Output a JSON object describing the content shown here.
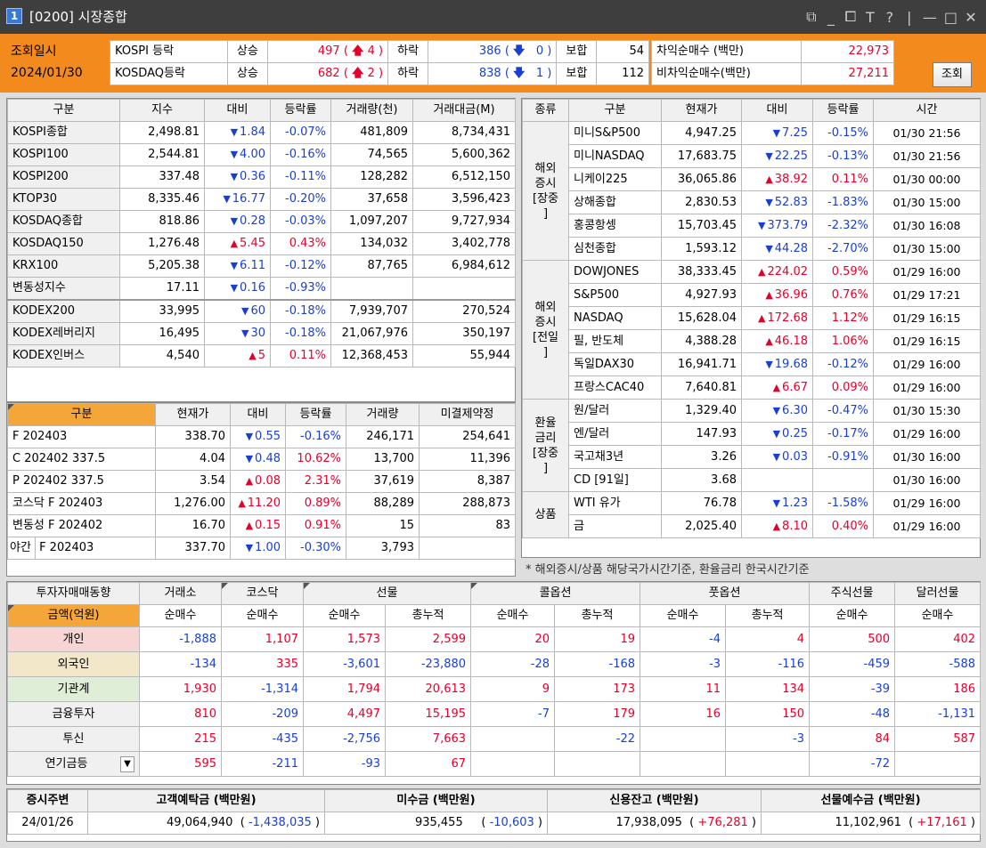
{
  "window": {
    "screen_number": "1",
    "title": "[0200] 시장종합",
    "tools": [
      "⧉",
      "_",
      "⧠",
      "T",
      "?",
      "|",
      "—",
      "□",
      "✕"
    ]
  },
  "header": {
    "query_date_label": "조회일시",
    "query_date": "2024/01/30",
    "rows": [
      {
        "market": "KOSPI 등락",
        "rise_label": "상승",
        "rise": "497",
        "upper": "4",
        "fall_label": "하락",
        "fall": "386",
        "lower": "0",
        "flat_label": "보합",
        "flat": "54"
      },
      {
        "market": "KOSDAQ등락",
        "rise_label": "상승",
        "rise": "682",
        "upper": "2",
        "fall_label": "하락",
        "fall": "838",
        "lower": "1",
        "flat_label": "보합",
        "flat": "112"
      }
    ],
    "arb_label": "차익순매수  (백만)",
    "arb_value": "22,973",
    "nonarb_label": "비차익순매수(백만)",
    "nonarb_value": "27,211",
    "search_button": "조회"
  },
  "index_table": {
    "headers": [
      "구분",
      "지수",
      "대비",
      "등락률",
      "거래량(천)",
      "거래대금(M)"
    ],
    "rows": [
      {
        "name": "KOSPI종합",
        "value": "2,498.81",
        "dir": "dn",
        "change": "1.84",
        "rate": "-0.07%",
        "volume": "481,809",
        "amount": "8,734,431"
      },
      {
        "name": "KOSPI100",
        "value": "2,544.81",
        "dir": "dn",
        "change": "4.00",
        "rate": "-0.16%",
        "volume": "74,565",
        "amount": "5,600,362"
      },
      {
        "name": "KOSPI200",
        "value": "337.48",
        "dir": "dn",
        "change": "0.36",
        "rate": "-0.11%",
        "volume": "128,282",
        "amount": "6,512,150"
      },
      {
        "name": "KTOP30",
        "value": "8,335.46",
        "dir": "dn",
        "change": "16.77",
        "rate": "-0.20%",
        "volume": "37,658",
        "amount": "3,596,423"
      },
      {
        "name": "KOSDAQ종합",
        "value": "818.86",
        "dir": "dn",
        "change": "0.28",
        "rate": "-0.03%",
        "volume": "1,097,207",
        "amount": "9,727,934"
      },
      {
        "name": "KOSDAQ150",
        "value": "1,276.48",
        "dir": "up",
        "change": "5.45",
        "rate": "0.43%",
        "volume": "134,032",
        "amount": "3,402,778"
      },
      {
        "name": "KRX100",
        "value": "5,205.38",
        "dir": "dn",
        "change": "6.11",
        "rate": "-0.12%",
        "volume": "87,765",
        "amount": "6,984,612"
      },
      {
        "name": "변동성지수",
        "value": "17.11",
        "dir": "dn",
        "change": "0.16",
        "rate": "-0.93%",
        "volume": "",
        "amount": ""
      },
      {
        "name": "KODEX200",
        "value": "33,995",
        "dir": "dn",
        "change": "60",
        "rate": "-0.18%",
        "volume": "7,939,707",
        "amount": "270,524"
      },
      {
        "name": "KODEX레버리지",
        "value": "16,495",
        "dir": "dn",
        "change": "30",
        "rate": "-0.18%",
        "volume": "21,067,976",
        "amount": "350,197"
      },
      {
        "name": "KODEX인버스",
        "value": "4,540",
        "dir": "up",
        "change": "5",
        "rate": "0.11%",
        "volume": "12,368,453",
        "amount": "55,944"
      }
    ]
  },
  "futures_table": {
    "headers": [
      "구분",
      "현재가",
      "대비",
      "등락률",
      "거래량",
      "미결제약정"
    ],
    "rows": [
      {
        "name": "F 202403",
        "value": "338.70",
        "dir": "dn",
        "change": "0.55",
        "rate": "-0.16%",
        "volume": "246,171",
        "oi": "254,641"
      },
      {
        "name": "C 202402 337.5",
        "value": "4.04",
        "dir": "dn",
        "change": "0.48",
        "rate": "10.62%",
        "volume": "13,700",
        "oi": "11,396"
      },
      {
        "name": "P 202402 337.5",
        "value": "3.54",
        "dir": "up",
        "change": "0.08",
        "rate": "2.31%",
        "volume": "37,619",
        "oi": "8,387"
      },
      {
        "name": "코스닥 F 202403",
        "value": "1,276.00",
        "dir": "up",
        "change": "11.20",
        "rate": "0.89%",
        "volume": "88,289",
        "oi": "288,873"
      },
      {
        "name": "변동성 F 202402",
        "value": "16.70",
        "dir": "up",
        "change": "0.15",
        "rate": "0.91%",
        "volume": "15",
        "oi": "83"
      },
      {
        "name": "F 202403",
        "prefix": "야간",
        "value": "337.70",
        "dir": "dn",
        "change": "1.00",
        "rate": "-0.30%",
        "volume": "3,793",
        "oi": ""
      }
    ]
  },
  "overseas_table": {
    "headers": [
      "종류",
      "구분",
      "현재가",
      "대비",
      "등락률",
      "시간"
    ],
    "groups": [
      {
        "label": "해외\n증시\n[장중\n]",
        "rows": [
          {
            "name": "미니S&P500",
            "value": "4,947.25",
            "dir": "dn",
            "change": "7.25",
            "rate": "-0.15%",
            "time": "01/30 21:56"
          },
          {
            "name": "미니NASDAQ",
            "value": "17,683.75",
            "dir": "dn",
            "change": "22.25",
            "rate": "-0.13%",
            "time": "01/30 21:56"
          },
          {
            "name": "니케이225",
            "value": "36,065.86",
            "dir": "up",
            "change": "38.92",
            "rate": "0.11%",
            "time": "01/30 00:00"
          },
          {
            "name": "상해종합",
            "value": "2,830.53",
            "dir": "dn",
            "change": "52.83",
            "rate": "-1.83%",
            "time": "01/30 15:00"
          },
          {
            "name": "홍콩항셍",
            "value": "15,703.45",
            "dir": "dn",
            "change": "373.79",
            "rate": "-2.32%",
            "time": "01/30 16:08"
          },
          {
            "name": "심천종합",
            "value": "1,593.12",
            "dir": "dn",
            "change": "44.28",
            "rate": "-2.70%",
            "time": "01/30 15:00"
          }
        ]
      },
      {
        "label": "해외\n증시\n[전일\n]",
        "rows": [
          {
            "name": "DOWJONES",
            "value": "38,333.45",
            "dir": "up",
            "change": "224.02",
            "rate": "0.59%",
            "time": "01/29 16:00"
          },
          {
            "name": "S&P500",
            "value": "4,927.93",
            "dir": "up",
            "change": "36.96",
            "rate": "0.76%",
            "time": "01/29 17:21"
          },
          {
            "name": "NASDAQ",
            "value": "15,628.04",
            "dir": "up",
            "change": "172.68",
            "rate": "1.12%",
            "time": "01/29 16:15"
          },
          {
            "name": "필, 반도체",
            "value": "4,388.28",
            "dir": "up",
            "change": "46.18",
            "rate": "1.06%",
            "time": "01/29 16:15"
          },
          {
            "name": "독일DAX30",
            "value": "16,941.71",
            "dir": "dn",
            "change": "19.68",
            "rate": "-0.12%",
            "time": "01/29 16:00"
          },
          {
            "name": "프랑스CAC40",
            "value": "7,640.81",
            "dir": "up",
            "change": "6.67",
            "rate": "0.09%",
            "time": "01/29 16:00"
          }
        ]
      },
      {
        "label": "환율\n금리\n[장중\n]",
        "rows": [
          {
            "name": "원/달러",
            "value": "1,329.40",
            "dir": "dn",
            "change": "6.30",
            "rate": "-0.47%",
            "time": "01/30 15:30"
          },
          {
            "name": "엔/달러",
            "value": "147.93",
            "dir": "dn",
            "change": "0.25",
            "rate": "-0.17%",
            "time": "01/29 16:00"
          },
          {
            "name": "국고채3년",
            "value": "3.26",
            "dir": "dn",
            "change": "0.03",
            "rate": "-0.91%",
            "time": "01/30 16:00"
          },
          {
            "name": "CD [91일]",
            "value": "3.68",
            "dir": "",
            "change": "",
            "rate": "",
            "time": "01/30 16:00"
          }
        ]
      },
      {
        "label": "상품",
        "rows": [
          {
            "name": "WTI 유가",
            "value": "76.78",
            "dir": "dn",
            "change": "1.23",
            "rate": "-1.58%",
            "time": "01/29 16:00"
          },
          {
            "name": "금",
            "value": "2,025.40",
            "dir": "up",
            "change": "8.10",
            "rate": "0.40%",
            "time": "01/29 16:00"
          }
        ]
      }
    ],
    "note": "* 해외증시/상품 해당국가시간기준, 환율금리 한국시간기준"
  },
  "investor_table": {
    "title": "투자자매매동향",
    "unit": "금액(억원)",
    "groups": [
      "거래소",
      "코스닥",
      "선물",
      "콜옵션",
      "풋옵션",
      "주식선물",
      "달러선물"
    ],
    "sub": [
      "순매수",
      "순매수",
      "순매수",
      "총누적",
      "순매수",
      "총누적",
      "순매수",
      "총누적",
      "순매수",
      "순매수"
    ],
    "rows": [
      {
        "name": "개인",
        "bg": "pink",
        "vals": [
          "-1,888",
          "1,107",
          "1,573",
          "2,599",
          "20",
          "19",
          "-4",
          "4",
          "500",
          "402"
        ]
      },
      {
        "name": "외국인",
        "bg": "tan",
        "vals": [
          "-134",
          "335",
          "-3,601",
          "-23,880",
          "-28",
          "-168",
          "-3",
          "-116",
          "-459",
          "-588"
        ]
      },
      {
        "name": "기관계",
        "bg": "green",
        "vals": [
          "1,930",
          "-1,314",
          "1,794",
          "20,613",
          "9",
          "173",
          "11",
          "134",
          "-39",
          "186"
        ]
      },
      {
        "name": "금융투자",
        "bg": "gray",
        "vals": [
          "810",
          "-209",
          "4,497",
          "15,195",
          "-7",
          "179",
          "16",
          "150",
          "-48",
          "-1,131"
        ]
      },
      {
        "name": "투신",
        "bg": "gray",
        "vals": [
          "215",
          "-435",
          "-2,756",
          "7,663",
          "",
          "-22",
          "",
          "-3",
          "84",
          "587"
        ]
      },
      {
        "name": "연기금등",
        "bg": "gray",
        "vals": [
          "595",
          "-211",
          "-93",
          "67",
          "",
          "",
          "",
          "",
          "-72",
          ""
        ]
      }
    ]
  },
  "footer": {
    "headers": [
      "증시주변",
      "고객예탁금 (백만원)",
      "미수금 (백만원)",
      "신용잔고 (백만원)",
      "선물예수금 (백만원)"
    ],
    "date": "24/01/26",
    "deposit": "49,064,940",
    "deposit_change": "-1,438,035",
    "unpaid": "935,455",
    "unpaid_change": "-10,603",
    "credit": "17,938,095",
    "credit_change": "+76,281",
    "futures_deposit": "11,102,961",
    "futures_deposit_change": "+17,161"
  },
  "colors": {
    "up": "#e4002b",
    "down": "#1a3fd0",
    "accent": "#f28a1e",
    "titlebar": "#3e3e3e"
  }
}
